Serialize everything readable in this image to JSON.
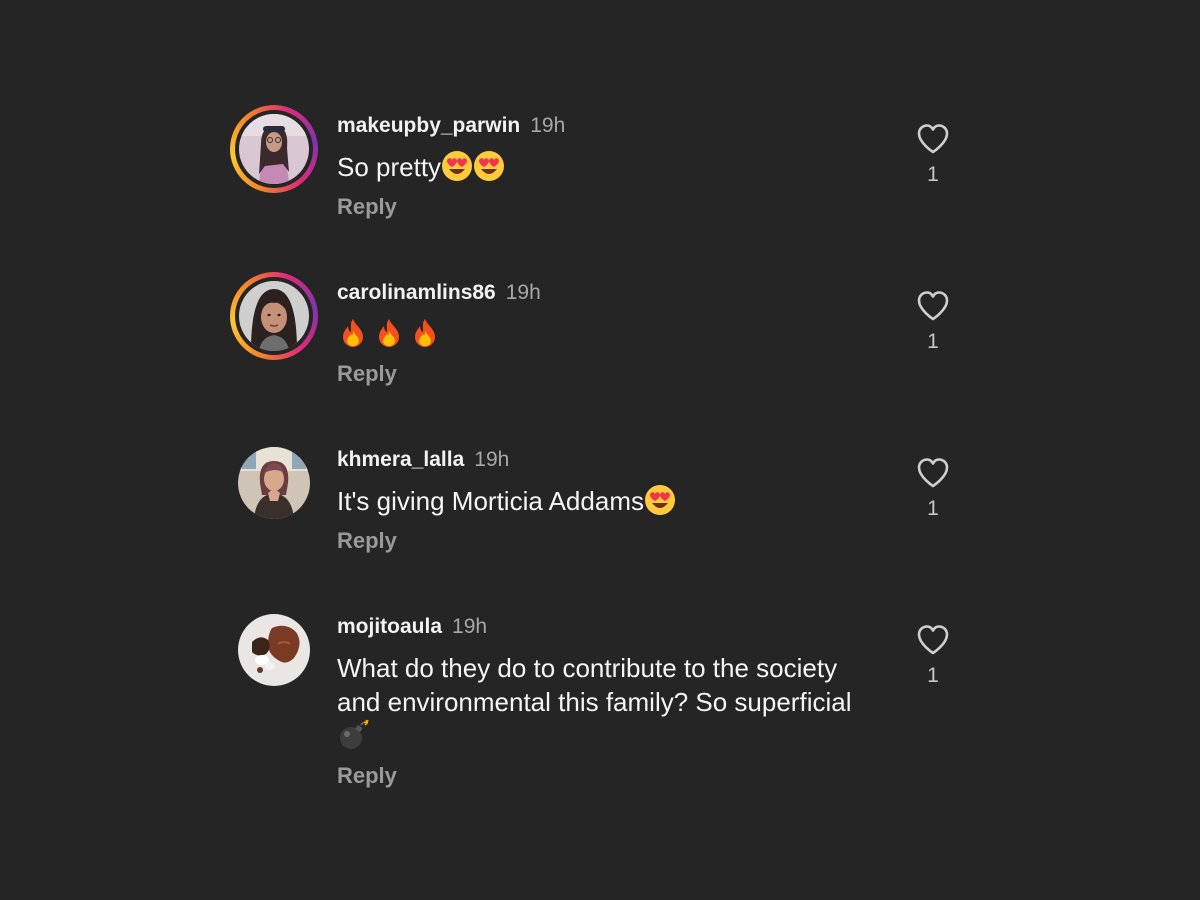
{
  "comments": [
    {
      "username": "makeupby_parwin",
      "time": "19h",
      "text": "So pretty",
      "emojis": [
        "heart-eyes",
        "heart-eyes"
      ],
      "reply_label": "Reply",
      "likes": "1",
      "story_ring": true
    },
    {
      "username": "carolinamlins86",
      "time": "19h",
      "text": "",
      "emojis": [
        "fire",
        "fire",
        "fire"
      ],
      "reply_label": "Reply",
      "likes": "1",
      "story_ring": true
    },
    {
      "username": "khmera_lalla",
      "time": "19h",
      "text": "It's giving Morticia Addams",
      "emojis": [
        "heart-eyes"
      ],
      "reply_label": "Reply",
      "likes": "1",
      "story_ring": false
    },
    {
      "username": "mojitoaula",
      "time": "19h",
      "text": "What do they do to contribute to the society and environmental this family? So superficial",
      "emojis": [
        "bomb"
      ],
      "reply_label": "Reply",
      "likes": "1",
      "story_ring": false
    }
  ],
  "colors": {
    "background": "#252525",
    "username": "#f2f2f2",
    "secondary_text": "#a8a8a8",
    "reply": "#9a9a9a"
  },
  "icons": {
    "like": "heart-outline-icon"
  }
}
